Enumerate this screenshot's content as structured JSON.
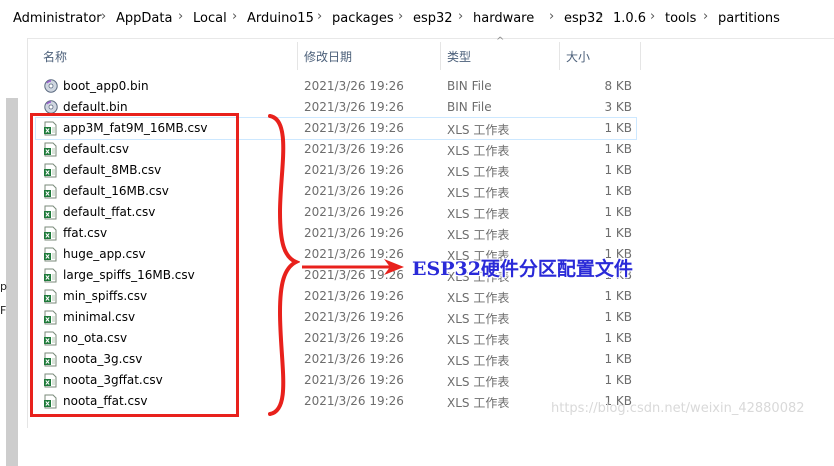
{
  "breadcrumb": [
    "Administrator",
    "AppData",
    "Local",
    "Arduino15",
    "packages",
    "esp32",
    "hardware",
    "esp32",
    "1.0.6",
    "tools",
    "partitions"
  ],
  "columns": {
    "name": "名称",
    "date": "修改日期",
    "type": "类型",
    "size": "大小"
  },
  "files": [
    {
      "name": "boot_app0.bin",
      "date": "2021/3/26 19:26",
      "type": "BIN File",
      "size": "8 KB",
      "icon": "bin-file-icon"
    },
    {
      "name": "default.bin",
      "date": "2021/3/26 19:26",
      "type": "BIN File",
      "size": "3 KB",
      "icon": "bin-file-icon"
    },
    {
      "name": "app3M_fat9M_16MB.csv",
      "date": "2021/3/26 19:26",
      "type": "XLS 工作表",
      "size": "1 KB",
      "icon": "csv-file-icon"
    },
    {
      "name": "default.csv",
      "date": "2021/3/26 19:26",
      "type": "XLS 工作表",
      "size": "1 KB",
      "icon": "csv-file-icon"
    },
    {
      "name": "default_8MB.csv",
      "date": "2021/3/26 19:26",
      "type": "XLS 工作表",
      "size": "1 KB",
      "icon": "csv-file-icon"
    },
    {
      "name": "default_16MB.csv",
      "date": "2021/3/26 19:26",
      "type": "XLS 工作表",
      "size": "1 KB",
      "icon": "csv-file-icon"
    },
    {
      "name": "default_ffat.csv",
      "date": "2021/3/26 19:26",
      "type": "XLS 工作表",
      "size": "1 KB",
      "icon": "csv-file-icon"
    },
    {
      "name": "ffat.csv",
      "date": "2021/3/26 19:26",
      "type": "XLS 工作表",
      "size": "1 KB",
      "icon": "csv-file-icon"
    },
    {
      "name": "huge_app.csv",
      "date": "2021/3/26 19:26",
      "type": "XLS 工作表",
      "size": "1 KB",
      "icon": "csv-file-icon"
    },
    {
      "name": "large_spiffs_16MB.csv",
      "date": "2021/3/26 19:26",
      "type": "XLS 工作表",
      "size": "1 KB",
      "icon": "csv-file-icon"
    },
    {
      "name": "min_spiffs.csv",
      "date": "2021/3/26 19:26",
      "type": "XLS 工作表",
      "size": "1 KB",
      "icon": "csv-file-icon"
    },
    {
      "name": "minimal.csv",
      "date": "2021/3/26 19:26",
      "type": "XLS 工作表",
      "size": "1 KB",
      "icon": "csv-file-icon"
    },
    {
      "name": "no_ota.csv",
      "date": "2021/3/26 19:26",
      "type": "XLS 工作表",
      "size": "1 KB",
      "icon": "csv-file-icon"
    },
    {
      "name": "noota_3g.csv",
      "date": "2021/3/26 19:26",
      "type": "XLS 工作表",
      "size": "1 KB",
      "icon": "csv-file-icon"
    },
    {
      "name": "noota_3gffat.csv",
      "date": "2021/3/26 19:26",
      "type": "XLS 工作表",
      "size": "1 KB",
      "icon": "csv-file-icon"
    },
    {
      "name": "noota_ffat.csv",
      "date": "2021/3/26 19:26",
      "type": "XLS 工作表",
      "size": "1 KB",
      "icon": "csv-file-icon"
    }
  ],
  "nav_fragments": [
    "p",
    "F"
  ],
  "annotation": {
    "label": "ESP32硬件分区配置文件",
    "color": "#e8211c",
    "text_color": "#2a2ad8"
  },
  "watermark": "https://blog.csdn.net/weixin_42880082"
}
